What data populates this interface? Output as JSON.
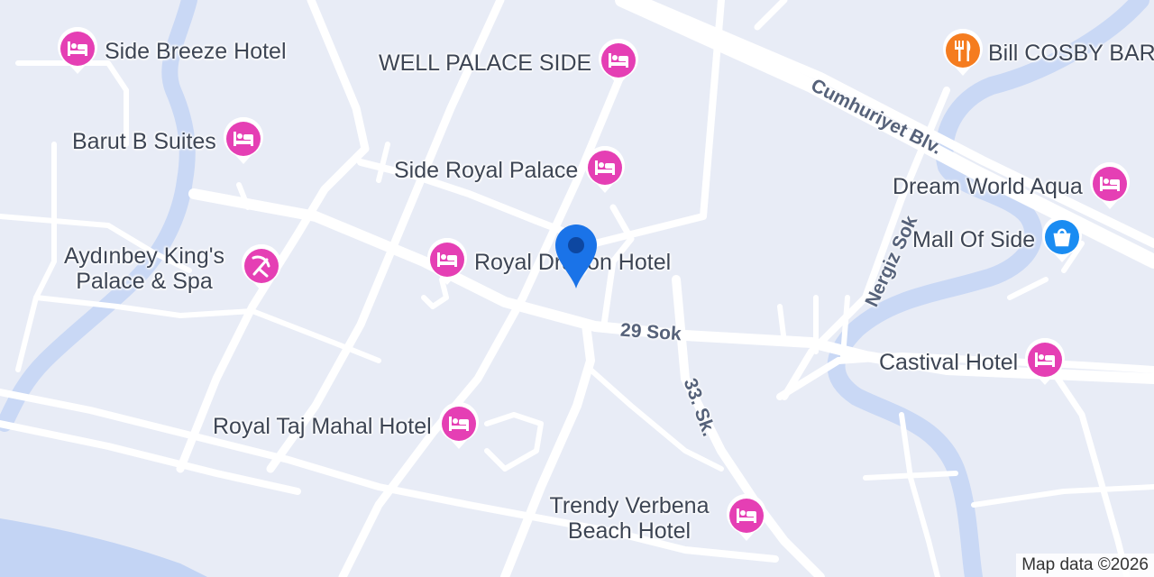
{
  "map": {
    "attribution": "Map data ©2026",
    "colors": {
      "land": "#e8ecf6",
      "road": "#ffffff",
      "water": "#c9d8f5",
      "hotel_pin": "#e53fb4",
      "restaurant_pin": "#f57c1f",
      "shopping_pin": "#1a8cf2",
      "location_marker": "#1a73e8"
    }
  },
  "pois": [
    {
      "name": "Side Breeze Hotel",
      "category": "hotel",
      "icon": "bed-icon"
    },
    {
      "name": "WELL PALACE SIDE",
      "category": "hotel",
      "icon": "bed-icon"
    },
    {
      "name": "Bill COSBY BAR RESTAURANT",
      "category": "restaurant",
      "icon": "fork-knife-icon"
    },
    {
      "name": "Barut B Suites",
      "category": "hotel",
      "icon": "bed-icon"
    },
    {
      "name": "Side Royal Palace",
      "category": "hotel",
      "icon": "bed-icon"
    },
    {
      "name": "Dream World Aqua",
      "category": "hotel",
      "icon": "bed-icon"
    },
    {
      "name": "Mall Of Side",
      "category": "shopping",
      "icon": "shopping-bag-icon"
    },
    {
      "name": "Aydınbey King's Palace & Spa",
      "category": "resort",
      "icon": "beach-umbrella-icon"
    },
    {
      "name": "Royal Dragon Hotel",
      "category": "hotel",
      "icon": "bed-icon"
    },
    {
      "name": "Castival Hotel",
      "category": "hotel",
      "icon": "bed-icon"
    },
    {
      "name": "Royal Taj Mahal Hotel",
      "category": "hotel",
      "icon": "bed-icon"
    },
    {
      "name": "Trendy Verbena Beach Hotel",
      "category": "hotel",
      "icon": "bed-icon"
    }
  ],
  "streets": {
    "cumhuriyet": "Cumhuriyet Blv.",
    "nergiz": "Nergiz Sok",
    "sok29": "29 Sok",
    "sk33": "33. Sk."
  }
}
